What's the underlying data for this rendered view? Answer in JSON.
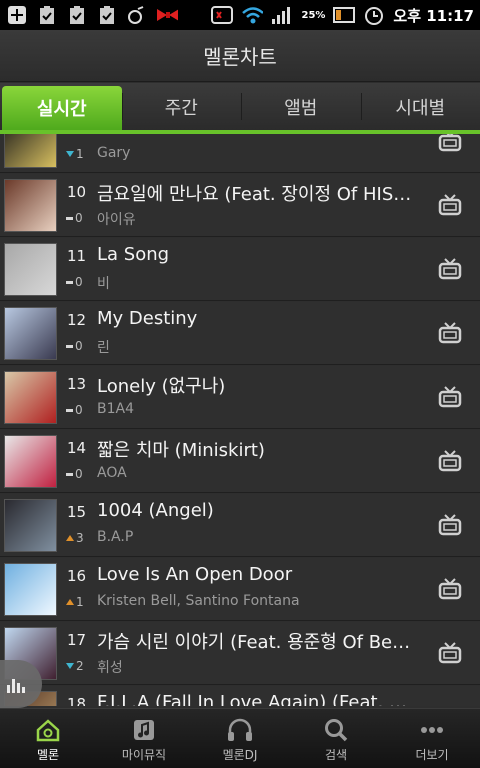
{
  "statusbar": {
    "battery": "25%",
    "time": "오후 11:17"
  },
  "header": {
    "title": "멜론차트"
  },
  "tabs": [
    {
      "label": "실시간",
      "active": true
    },
    {
      "label": "주간",
      "active": false
    },
    {
      "label": "앨범",
      "active": false
    },
    {
      "label": "시대별",
      "active": false
    }
  ],
  "chart": [
    {
      "rank": "",
      "title": "",
      "change_dir": "down",
      "change": "1",
      "artist": "Gary"
    },
    {
      "rank": "10",
      "title": "금요일에 만나요 (Feat. 장이정 Of HISTORY)",
      "change_dir": "same",
      "change": "0",
      "artist": "아이유"
    },
    {
      "rank": "11",
      "title": "La Song",
      "change_dir": "same",
      "change": "0",
      "artist": "비"
    },
    {
      "rank": "12",
      "title": "My Destiny",
      "change_dir": "same",
      "change": "0",
      "artist": "린"
    },
    {
      "rank": "13",
      "title": "Lonely (없구나)",
      "change_dir": "same",
      "change": "0",
      "artist": "B1A4"
    },
    {
      "rank": "14",
      "title": "짧은 치마 (Miniskirt)",
      "change_dir": "same",
      "change": "0",
      "artist": "AOA"
    },
    {
      "rank": "15",
      "title": "1004 (Angel)",
      "change_dir": "up",
      "change": "3",
      "artist": "B.A.P"
    },
    {
      "rank": "16",
      "title": "Love Is An Open Door",
      "change_dir": "up",
      "change": "1",
      "artist": "Kristen Bell, Santino Fontana"
    },
    {
      "rank": "17",
      "title": "가슴 시린 이야기 (Feat. 용준형 Of Beast)",
      "change_dir": "down",
      "change": "2",
      "artist": "휘성"
    },
    {
      "rank": "18",
      "title": "F.I.L.A (Fall In Love Again) (Feat. DJ Dopsh)",
      "change_dir": "",
      "change": "",
      "artist": ""
    }
  ],
  "bottomnav": [
    {
      "label": "멜론",
      "icon": "home-icon",
      "active": true
    },
    {
      "label": "마이뮤직",
      "icon": "music-note-icon",
      "active": false
    },
    {
      "label": "멜론DJ",
      "icon": "headphones-icon",
      "active": false
    },
    {
      "label": "검색",
      "icon": "search-icon",
      "active": false
    },
    {
      "label": "더보기",
      "icon": "more-icon",
      "active": false
    }
  ],
  "colors": {
    "accent": "#68c22a",
    "up": "#e0902a",
    "down": "#3fb6d0"
  }
}
